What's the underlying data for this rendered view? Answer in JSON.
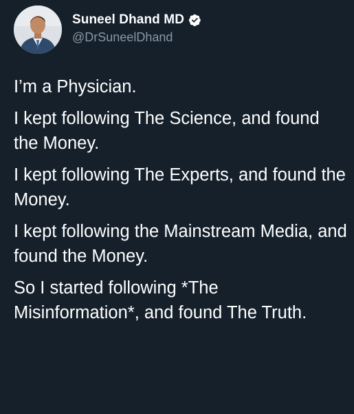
{
  "author": {
    "display_name": "Suneel Dhand MD",
    "handle": "@DrSuneelDhand",
    "verified": true,
    "avatar_icon": "profile-photo",
    "verified_icon": "verified-badge-icon"
  },
  "colors": {
    "background": "#15202b",
    "text": "#ffffff",
    "secondary_text": "#8899a6",
    "verified_badge": "#1d9bf0"
  },
  "tweet": {
    "paragraphs": [
      "I’m a Physician.",
      "I kept following The Science, and found the Money.",
      "I kept following The Experts, and found the Money.",
      "I kept following the Mainstream Media, and found the Money.",
      "So I started following *The Misinformation*, and found The Truth."
    ]
  }
}
